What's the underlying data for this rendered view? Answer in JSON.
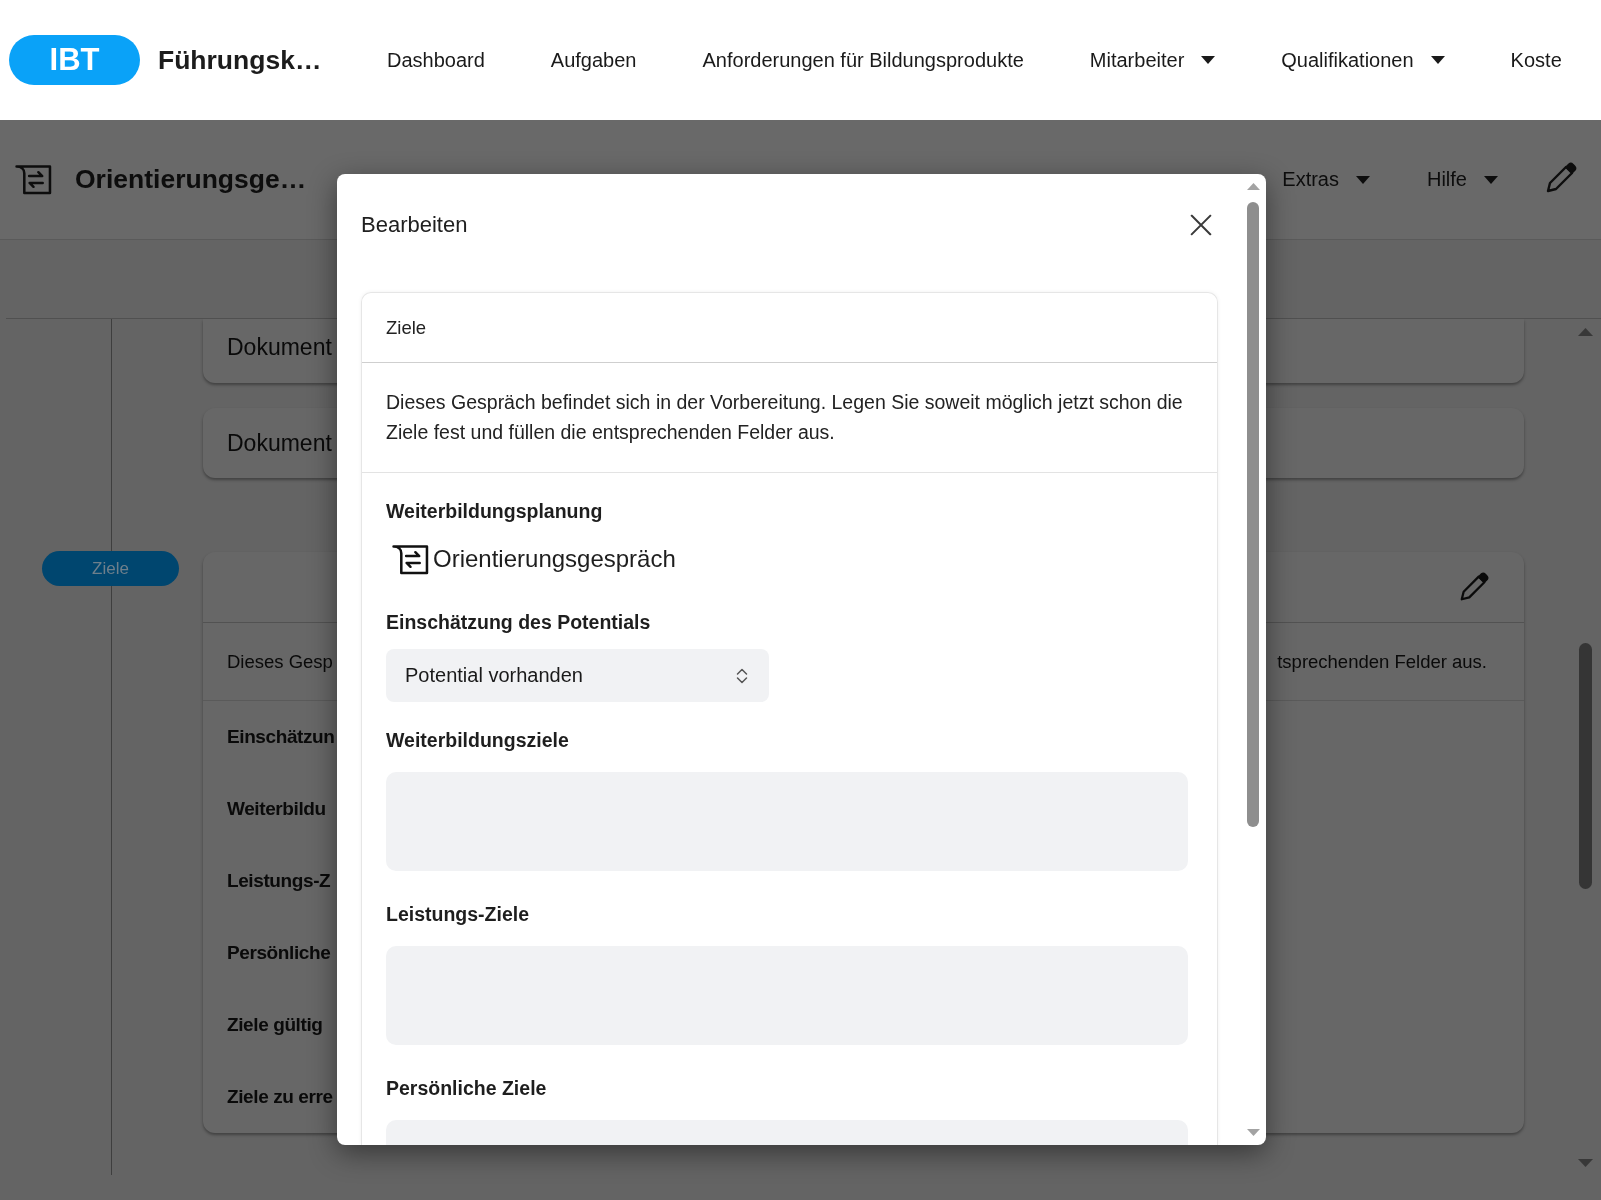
{
  "top_nav": {
    "logo": "IBT",
    "title": "Führungsk…",
    "items": [
      {
        "label": "Dashboard",
        "has_menu": false
      },
      {
        "label": "Aufgaben",
        "has_menu": false
      },
      {
        "label": "Anforderungen für Bildungsprodukte",
        "has_menu": false
      },
      {
        "label": "Mitarbeiter",
        "has_menu": true
      },
      {
        "label": "Qualifikationen",
        "has_menu": true
      },
      {
        "label": "Koste",
        "has_menu": false
      }
    ]
  },
  "page_header": {
    "title": "Orientierungsge…",
    "menus": [
      {
        "label": "Extras",
        "has_menu": true
      },
      {
        "label": "Hilfe",
        "has_menu": true
      }
    ]
  },
  "page": {
    "cards": [
      {
        "title": "Dokument"
      },
      {
        "title": "Dokument"
      }
    ],
    "section_chip": "Ziele",
    "goals_card": {
      "intro_start": "Dieses Gesp",
      "intro_end": "tsprechenden Felder aus.",
      "rows": [
        "Einschätzun",
        "Weiterbildu",
        "Leistungs-Z",
        "Persönliche",
        "Ziele gültig",
        "Ziele zu erre"
      ]
    }
  },
  "dialog": {
    "title": "Bearbeiten",
    "card": {
      "title": "Ziele",
      "intro": "Dieses Gespräch befindet sich in der Vorbereitung. Legen Sie soweit möglich jetzt schon die Ziele fest und füllen die entsprechenden Felder aus.",
      "plan": {
        "label": "Weiterbildungsplanung",
        "value": "Orientierungsgespräch"
      },
      "fields": [
        {
          "kind": "select",
          "label": "Einschätzung des Potentials",
          "value": "Potential vorhanden"
        },
        {
          "kind": "textarea",
          "label": "Weiterbildungsziele"
        },
        {
          "kind": "textarea",
          "label": "Leistungs-Ziele"
        },
        {
          "kind": "textarea",
          "label": "Persönliche Ziele"
        }
      ]
    }
  }
}
